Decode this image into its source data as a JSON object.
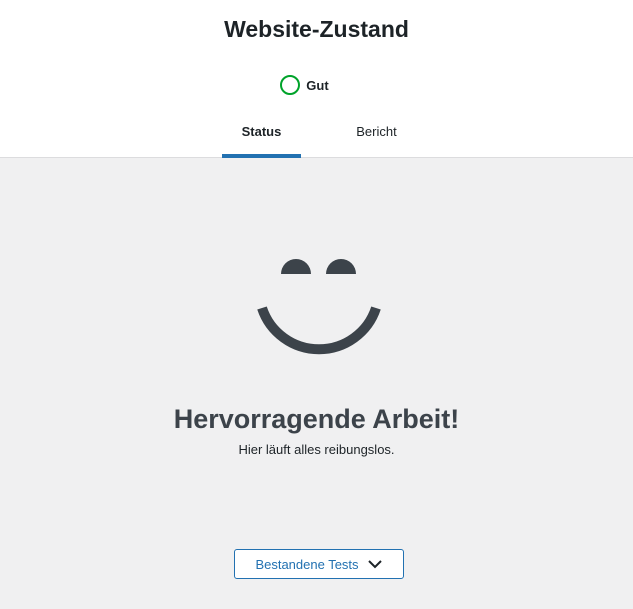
{
  "header": {
    "title": "Website-Zustand",
    "status_label": "Gut",
    "status_color": "#00a32a"
  },
  "tabs": [
    {
      "label": "Status",
      "active": true
    },
    {
      "label": "Bericht",
      "active": false
    }
  ],
  "main": {
    "icon": "smiley-face-icon",
    "headline": "Hervorragende Arbeit!",
    "subtext": "Hier läuft alles reibungslos.",
    "passed_tests_button": "Bestandene Tests",
    "button_icon": "chevron-down-icon"
  },
  "colors": {
    "accent": "#2271b1",
    "background": "#f0f0f1",
    "icon": "#3c434a"
  }
}
